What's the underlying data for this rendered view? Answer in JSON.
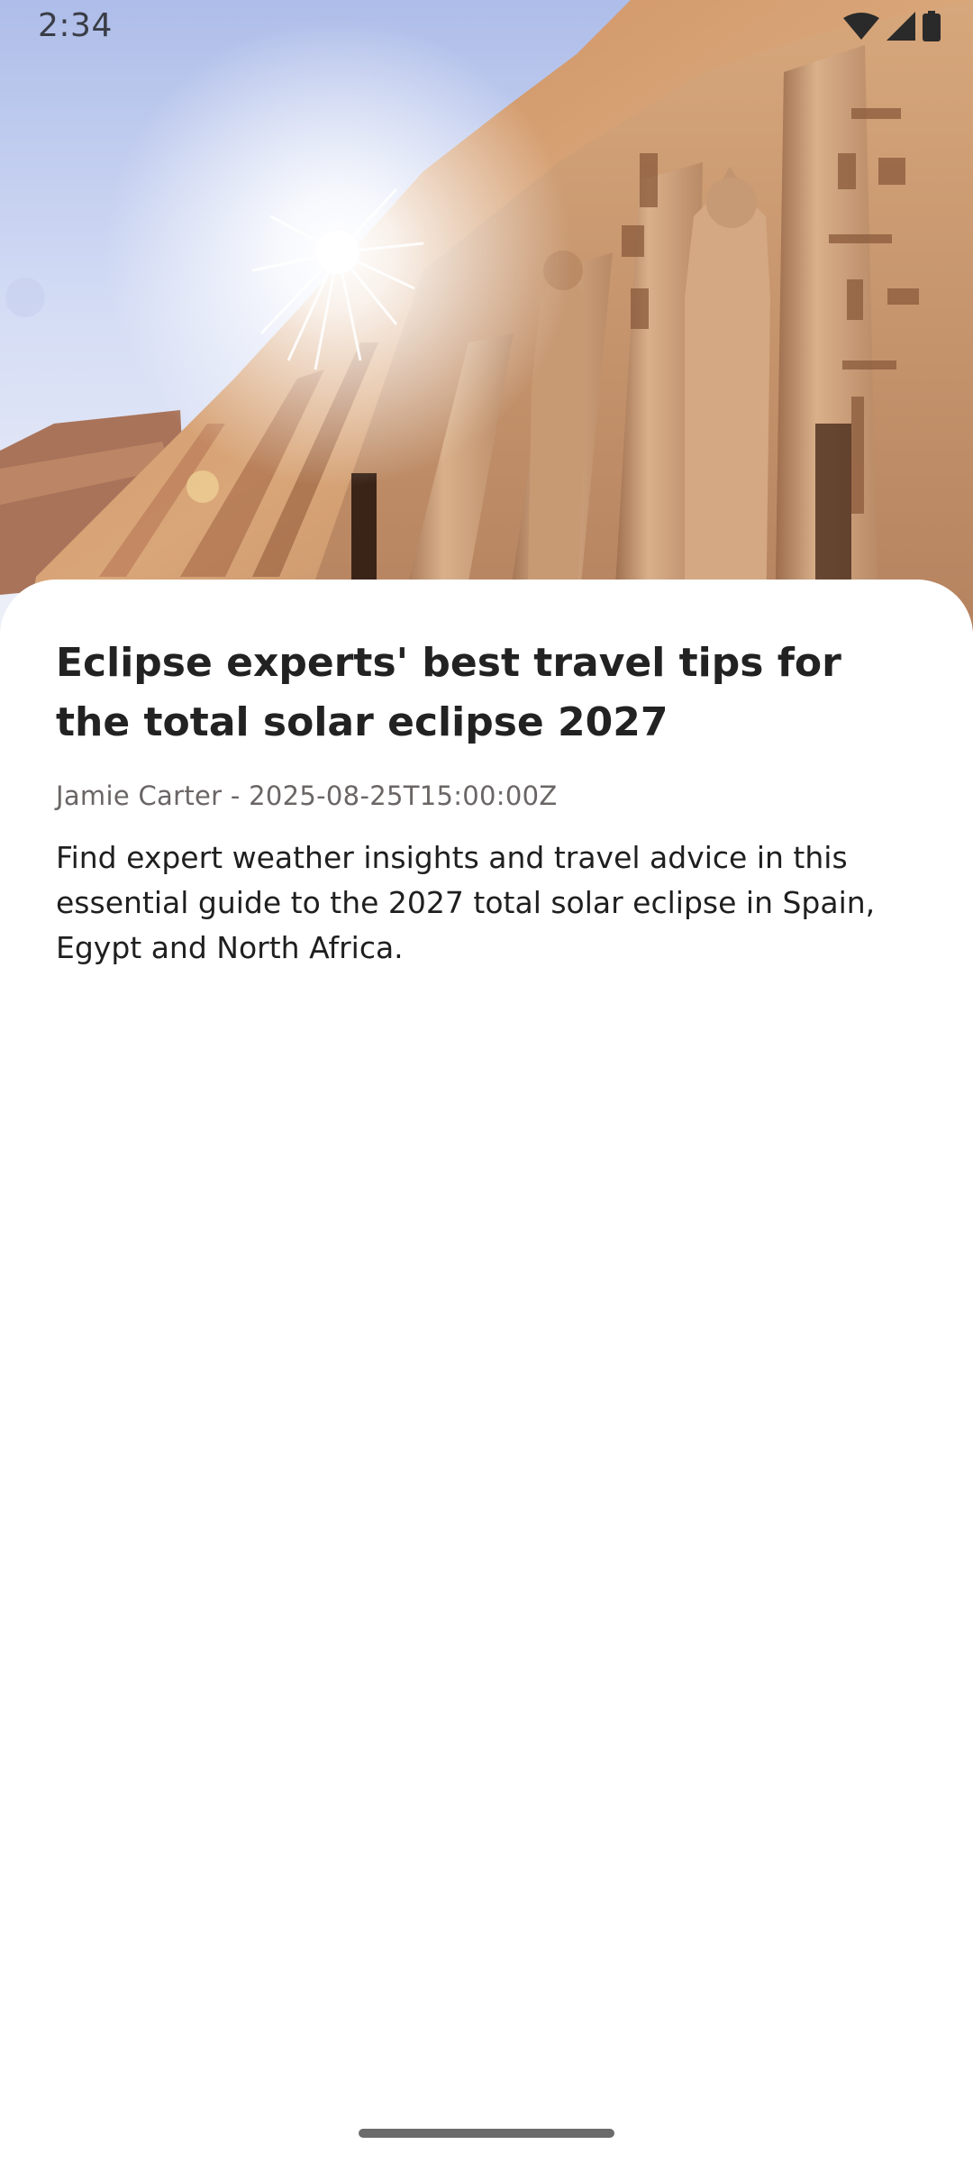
{
  "status_bar": {
    "time": "2:34",
    "icons": [
      "wifi-icon",
      "cellular-signal-icon",
      "battery-icon"
    ]
  },
  "hero": {
    "image": "photo of ancient Egyptian temple facade with carved pharaoh statues under bright sun",
    "colors": {
      "sky_top": "#b9c7ee",
      "sky_bottom": "#eef1fb",
      "stone_light": "#d7a476",
      "stone_dark": "#8a5a3c"
    }
  },
  "article": {
    "title": "Eclipse experts' best travel tips for the total solar eclipse 2027",
    "byline": "Jamie Carter - 2025-08-25T15:00:00Z",
    "summary": "Find expert weather insights and travel advice in this essential guide to the 2027 total solar eclipse in Spain, Egypt and North Africa."
  }
}
